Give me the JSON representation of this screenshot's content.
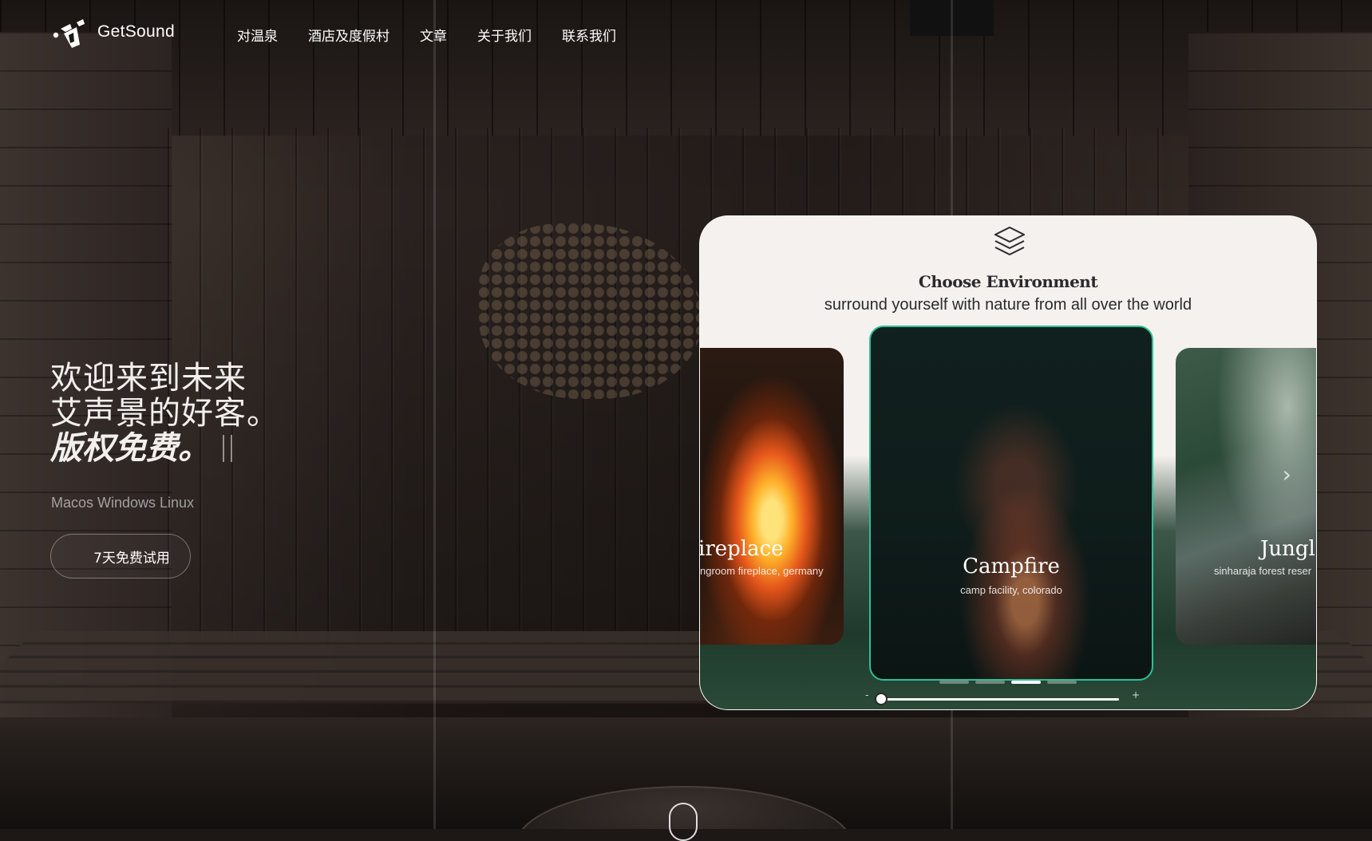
{
  "brand": {
    "name": "GetSound",
    "logo_icon": "getsound-logo-icon"
  },
  "nav": {
    "items": [
      {
        "label": "对温泉"
      },
      {
        "label": "酒店及度假村"
      },
      {
        "label": "文章"
      },
      {
        "label": "关于我们"
      },
      {
        "label": "联系我们"
      }
    ]
  },
  "hero": {
    "line1": "欢迎来到未来",
    "line2": "艾声景的好客。",
    "line3": "版权免费。",
    "platforms": "Macos Windows Linux",
    "cta_label": "7天免费试用"
  },
  "app_card": {
    "icon": "layers-icon",
    "title": "Choose Environment",
    "subtitle": "surround yourself with nature from all over the world",
    "environments": [
      {
        "name": "Fireplace",
        "visible_name": "ireplace",
        "location": "ngroom fireplace, germany"
      },
      {
        "name": "Campfire",
        "visible_name": "Campfire",
        "location": "camp facility, colorado"
      },
      {
        "name": "Jungle",
        "visible_name": "Jungl",
        "location": "sinharaja forest reser"
      }
    ],
    "carousel_pages": 4,
    "carousel_active_page": 3,
    "volume": {
      "minus": "-",
      "plus": "+",
      "level": 0.02
    },
    "accent_color": "#2fbf94"
  }
}
